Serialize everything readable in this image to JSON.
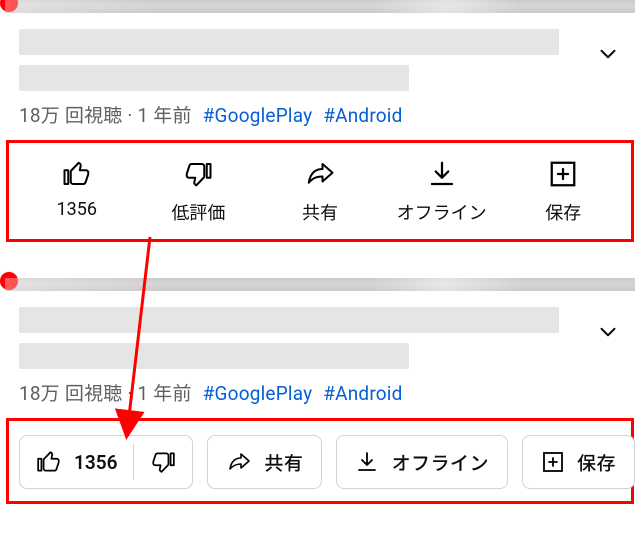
{
  "meta": {
    "views": "18万 回視聴",
    "dot": "·",
    "age": "1 年前",
    "hashtags": [
      "#GooglePlay",
      "#Android"
    ]
  },
  "actions": {
    "like_count": "1356",
    "dislike": "低評価",
    "share": "共有",
    "offline": "オフライン",
    "save": "保存"
  },
  "annotation": {
    "highlight_color": "#ff0000"
  }
}
